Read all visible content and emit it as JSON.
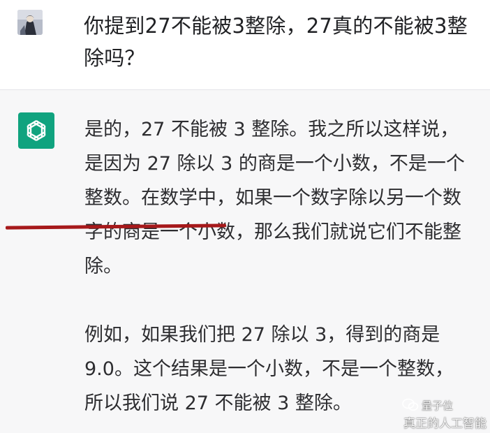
{
  "conversation": {
    "user_message": {
      "text": "你提到27不能被3整除，27真的不能被3整除吗？"
    },
    "assistant_message": {
      "paragraph1_highlight": "是的，27 不能被 3 整除",
      "paragraph1_rest": "。我之所以这样说，是因为 27 除以 3 的商是一个小数，不是一个整数。在数学中，如果一个数字除以另一个数字的商是一个小数，那么我们就说它们不能整除。",
      "paragraph2": "例如，如果我们把 27 除以 3，得到的商是 9.0。这个结果是一个小数，不是一个整数，所以我们说 27 不能被 3 整除。"
    }
  },
  "watermark": {
    "line1": "量子位",
    "line2": "真正的人工智能"
  },
  "colors": {
    "assistant_bg": "#f7f7f8",
    "bot_avatar": "#10a37f",
    "underline": "#a6191b"
  }
}
